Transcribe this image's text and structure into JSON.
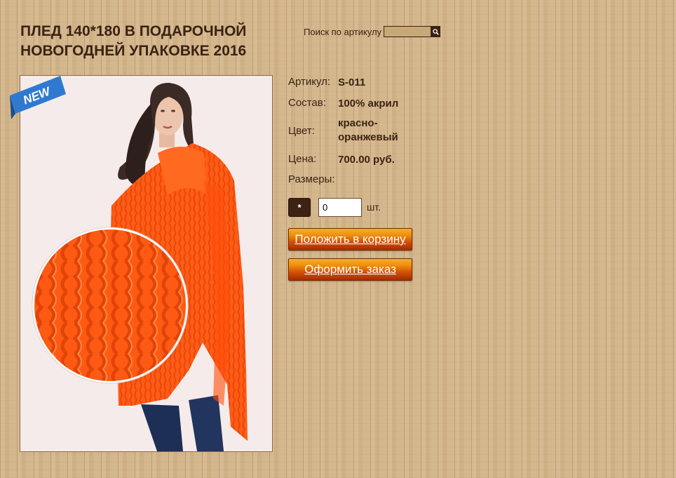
{
  "product": {
    "title": "ПЛЕД 140*180 В ПОДАРОЧНОЙ НОВОГОДНЕЙ УПАКОВКЕ 2016",
    "badge": "NEW",
    "properties": [
      {
        "label": "Артикул:",
        "value": "S-011"
      },
      {
        "label": "Состав:",
        "value": "100% акрил"
      },
      {
        "label": "Цвет:",
        "value": "красно-оранжевый"
      },
      {
        "label": "Цена:",
        "value": "700.00 руб."
      }
    ],
    "sizes_label": "Размеры:",
    "size_option": "*",
    "quantity": "0",
    "unit": "шт.",
    "add_to_cart": "Положить в корзину",
    "checkout": "Оформить заказ"
  },
  "search": {
    "label": "Поиск по артикулу",
    "value": ""
  },
  "colors": {
    "text": "#3a2313",
    "plaid": "#ff5a14",
    "button_top": "#f3b125",
    "button_bottom": "#a52c00",
    "badge": "#2f7ad0"
  }
}
